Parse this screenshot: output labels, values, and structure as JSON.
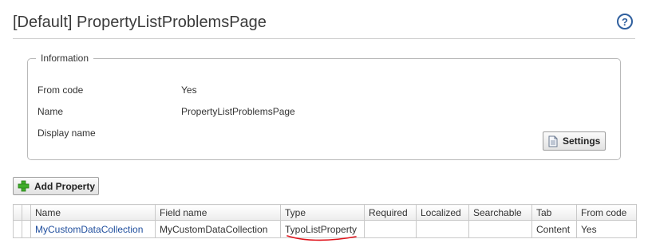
{
  "page": {
    "title": "[Default] PropertyListProblemsPage"
  },
  "info": {
    "legend": "Information",
    "rows": [
      {
        "label": "From code",
        "value": "Yes"
      },
      {
        "label": "Name",
        "value": "PropertyListProblemsPage"
      },
      {
        "label": "Display name",
        "value": ""
      }
    ],
    "settings_label": "Settings"
  },
  "toolbar": {
    "add_property_label": "Add Property"
  },
  "table": {
    "headers": {
      "name": "Name",
      "field_name": "Field name",
      "type": "Type",
      "required": "Required",
      "localized": "Localized",
      "searchable": "Searchable",
      "tab": "Tab",
      "from_code": "From code"
    },
    "rows": [
      {
        "name": "MyCustomDataCollection",
        "field_name": "MyCustomDataCollection",
        "type": "TypoListProperty",
        "required": "",
        "localized": "",
        "searchable": "",
        "tab": "Content",
        "from_code": "Yes"
      }
    ]
  },
  "colors": {
    "link": "#1f4e9d",
    "annotation": "#e0141c",
    "add_icon": "#3fae2a",
    "help_icon": "#2f5f9e"
  },
  "icons": {
    "help": "help-question-icon",
    "settings": "document-icon",
    "add": "plus-icon"
  }
}
